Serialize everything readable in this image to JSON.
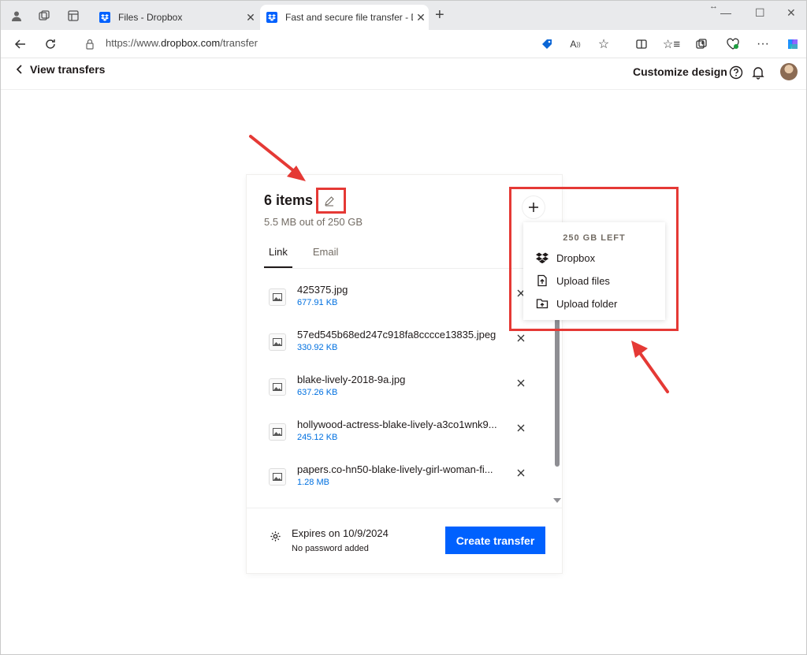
{
  "browser": {
    "tabs": [
      {
        "title": "Files - Dropbox",
        "active": false
      },
      {
        "title": "Fast and secure file transfer - Dropbox",
        "active": true
      }
    ],
    "url_prefix": "https://www.",
    "url_domain": "dropbox.com",
    "url_path": "/transfer"
  },
  "header": {
    "back_label": "View transfers",
    "customize_label": "Customize design"
  },
  "transfer": {
    "title": "6 items",
    "storage": "5.5 MB out of 250 GB",
    "tabs": [
      "Link",
      "Email"
    ],
    "files": [
      {
        "name": "425375.jpg",
        "size": "677.91 KB"
      },
      {
        "name": "57ed545b68ed247c918fa8cccce13835.jpeg",
        "size": "330.92 KB"
      },
      {
        "name": "blake-lively-2018-9a.jpg",
        "size": "637.26 KB"
      },
      {
        "name": "hollywood-actress-blake-lively-a3co1wnk9...",
        "size": "245.12 KB"
      },
      {
        "name": "papers.co-hn50-blake-lively-girl-woman-fi...",
        "size": "1.28 MB"
      }
    ],
    "expires": "Expires on 10/9/2024",
    "password": "No password added",
    "create_label": "Create transfer"
  },
  "add_menu": {
    "header": "250 GB LEFT",
    "items": [
      "Dropbox",
      "Upload files",
      "Upload folder"
    ]
  },
  "colors": {
    "accent": "#0061fe",
    "annotation": "#e53935",
    "file_size": "#0070e0"
  }
}
